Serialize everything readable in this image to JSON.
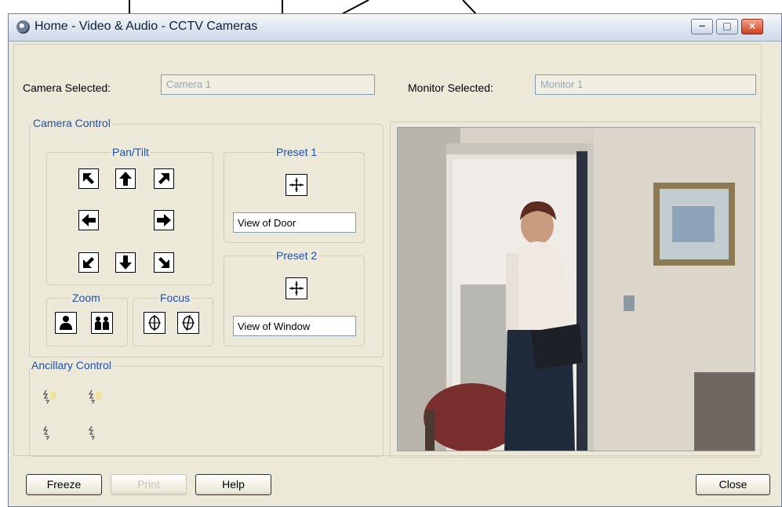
{
  "window": {
    "title": "Home - Video & Audio - CCTV Cameras",
    "minimize": "−",
    "maximize": "□",
    "close": "×"
  },
  "selection": {
    "camera_label": "Camera Selected:",
    "camera_value": "Camera 1",
    "monitor_label": "Monitor Selected:",
    "monitor_value": "Monitor 1"
  },
  "camera_control": {
    "legend": "Camera Control",
    "pan_tilt": "Pan/Tilt",
    "zoom": "Zoom",
    "focus": "Focus",
    "preset1": {
      "legend": "Preset 1",
      "name": "View of Door"
    },
    "preset2": {
      "legend": "Preset 2",
      "name": "View of Window"
    }
  },
  "ancillary": {
    "legend": "Ancillary Control",
    "icons": [
      "lamp-on-icon",
      "lamp-on-icon",
      "lamp-off-icon",
      "lamp-off-icon"
    ]
  },
  "buttons": {
    "freeze": "Freeze",
    "print": "Print",
    "help": "Help",
    "close": "Close"
  },
  "colors": {
    "legend": "#1f4fb5",
    "window_bg": "#ece9d8",
    "field_text": "#9aa7b6"
  }
}
